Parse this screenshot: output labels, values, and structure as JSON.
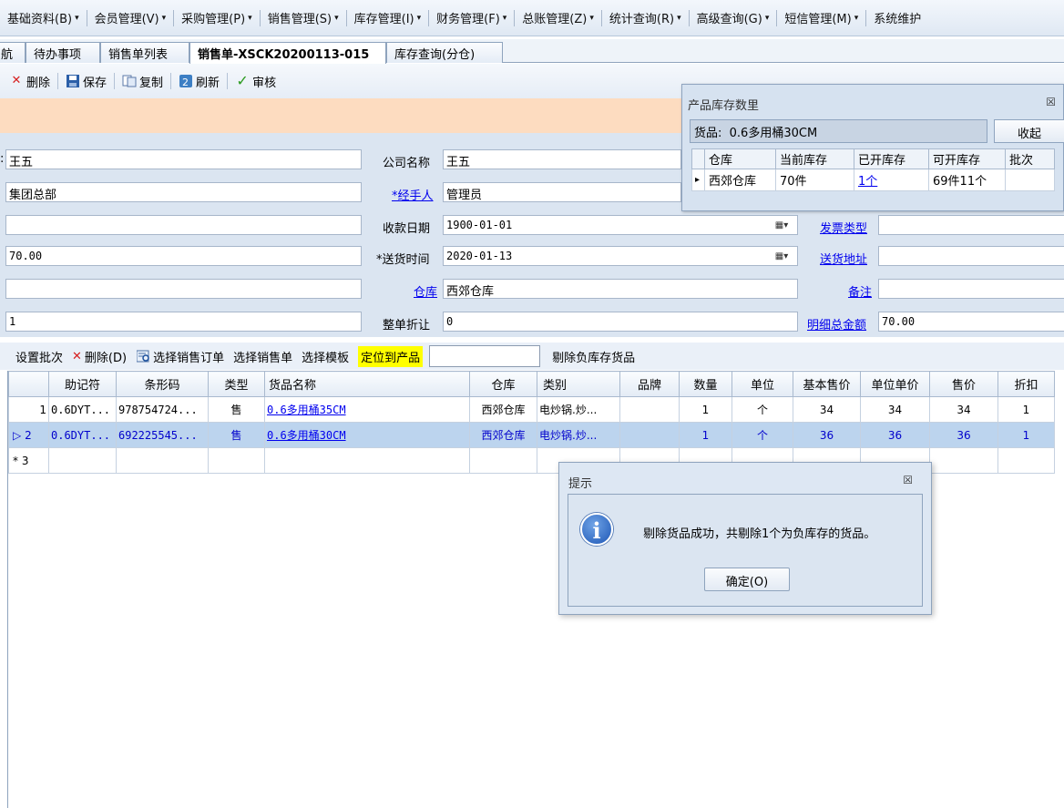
{
  "menu": [
    {
      "label": "基础资料(B)"
    },
    {
      "label": "会员管理(V)"
    },
    {
      "label": "采购管理(P)"
    },
    {
      "label": "销售管理(S)"
    },
    {
      "label": "库存管理(I)"
    },
    {
      "label": "财务管理(F)"
    },
    {
      "label": "总账管理(Z)"
    },
    {
      "label": "统计查询(R)"
    },
    {
      "label": "高级查询(G)"
    },
    {
      "label": "短信管理(M)"
    },
    {
      "label": "系统维护"
    }
  ],
  "tabs": [
    {
      "label": "航"
    },
    {
      "label": "待办事项"
    },
    {
      "label": "销售单列表"
    },
    {
      "label": "销售单-XSCK20200113-015"
    },
    {
      "label": "库存查询(分仓)"
    }
  ],
  "toolbar": {
    "delete": "删除",
    "save": "保存",
    "copy": "复制",
    "refresh": "刷新",
    "approve": "审核"
  },
  "form": {
    "customer_value": "王五",
    "dept_value": "集团总部",
    "field3_value": "",
    "amount_value": "70.00",
    "field5_value": "",
    "field6_value": "1",
    "company_label": "公司名称",
    "company_value": "王五",
    "handler_label": "*经手人",
    "handler_value": "管理员",
    "collect_date_label": "收款日期",
    "collect_date_value": "1900-01-01",
    "delivery_time_label": "*送货时间",
    "delivery_time_value": "2020-01-13",
    "warehouse_label": "仓库",
    "warehouse_value": "西郊仓库",
    "discount_label": "整单折让",
    "discount_value": "0",
    "invoice_type_label": "发票类型",
    "invoice_type_value": "",
    "delivery_addr_label": "送货地址",
    "delivery_addr_value": "",
    "remark_label": "备注",
    "remark_value": "",
    "detail_total_label": "明细总金额",
    "detail_total_value": "70.00"
  },
  "detail_toolbar": {
    "set_batch": "设置批次",
    "delete": "删除(D)",
    "select_order": "选择销售订单",
    "select_sale": "选择销售单",
    "select_template": "选择模板",
    "locate": "定位到产品",
    "locate_value": "",
    "remove_negative": "剔除负库存货品"
  },
  "grid": {
    "columns": [
      "助记符",
      "条形码",
      "类型",
      "货品名称",
      "仓库",
      "类别",
      "品牌",
      "数量",
      "单位",
      "基本售价",
      "单位单价",
      "售价",
      "折扣"
    ],
    "rows": [
      {
        "no": "1",
        "marker": "",
        "code": "0.6DYT...",
        "barcode": "978754724...",
        "type": "售",
        "name": "0.6多用桶35CM",
        "warehouse": "西郊仓库",
        "category": "电炒锅.炒...",
        "brand": "",
        "qty": "1",
        "unit": "个",
        "base_price": "34",
        "unit_price": "34",
        "price": "34",
        "discount": "1"
      },
      {
        "no": "2",
        "marker": "▷",
        "code": "0.6DYT...",
        "barcode": "692225545...",
        "type": "售",
        "name": "0.6多用桶30CM",
        "warehouse": "西郊仓库",
        "category": "电炒锅.炒...",
        "brand": "",
        "qty": "1",
        "unit": "个",
        "base_price": "36",
        "unit_price": "36",
        "price": "36",
        "discount": "1"
      },
      {
        "no": "3",
        "marker": "*",
        "code": "",
        "barcode": "",
        "type": "",
        "name": "",
        "warehouse": "",
        "category": "",
        "brand": "",
        "qty": "",
        "unit": "",
        "base_price": "",
        "unit_price": "",
        "price": "",
        "discount": ""
      }
    ]
  },
  "stock_panel": {
    "title": "产品库存数里",
    "goods_label": "货品:",
    "goods_value": "0.6多用桶30CM",
    "collapse": "收起",
    "columns": [
      "仓库",
      "当前库存",
      "已开库存",
      "可开库存",
      "批次"
    ],
    "rows": [
      {
        "marker": "▸",
        "warehouse": "西郊仓库",
        "current": "70件",
        "opened": "1个",
        "available": "69件11个",
        "batch": ""
      }
    ]
  },
  "dialog": {
    "title": "提示",
    "message": "剔除货品成功，共剔除1个为负库存的货品。",
    "ok": "确定(O)"
  },
  "colors": {
    "warn_bar": "#fddcc0",
    "form_bg": "#dbe5f1",
    "selected_row": "#bcd4ee",
    "link": "#0000ee",
    "locate_highlight": "#ffff00"
  }
}
